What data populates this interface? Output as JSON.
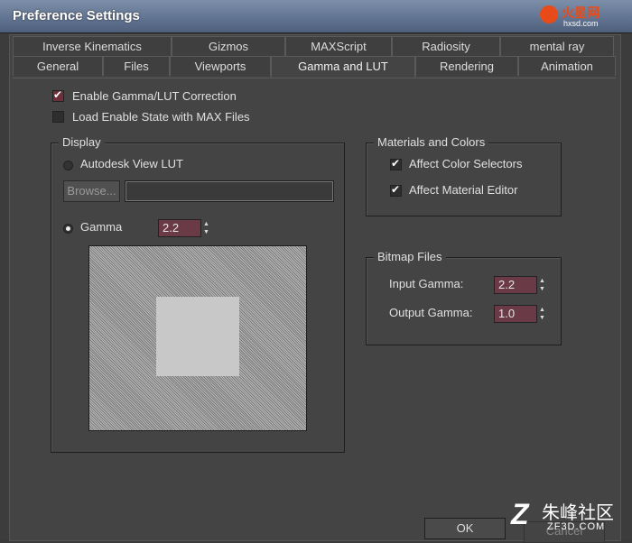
{
  "window": {
    "title": "Preference Settings"
  },
  "logo": {
    "name": "火星网",
    "url": "hxsd.com"
  },
  "tabs": {
    "row1": [
      "Inverse Kinematics",
      "Gizmos",
      "MAXScript",
      "Radiosity",
      "mental ray"
    ],
    "row2": [
      "General",
      "Files",
      "Viewports",
      "Gamma and LUT",
      "Rendering",
      "Animation"
    ],
    "active": "Gamma and LUT"
  },
  "options": {
    "enable_gamma": {
      "label": "Enable Gamma/LUT Correction",
      "checked": true
    },
    "load_enable_state": {
      "label": "Load Enable State with MAX Files",
      "checked": false
    }
  },
  "display": {
    "title": "Display",
    "lut_label": "Autodesk View LUT",
    "browse_label": "Browse...",
    "path_value": "",
    "gamma_label": "Gamma",
    "gamma_value": "2.2",
    "gamma_selected": true
  },
  "materials": {
    "title": "Materials and Colors",
    "affect_color_selectors": {
      "label": "Affect Color Selectors",
      "checked": true
    },
    "affect_material_editor": {
      "label": "Affect Material Editor",
      "checked": true
    }
  },
  "bitmap": {
    "title": "Bitmap Files",
    "input_gamma_label": "Input Gamma:",
    "input_gamma_value": "2.2",
    "output_gamma_label": "Output Gamma:",
    "output_gamma_value": "1.0"
  },
  "footer": {
    "ok_label": "OK",
    "cancel_label": "Cancel"
  },
  "watermark": {
    "glyph": "Z",
    "cn": "朱峰社区",
    "en": "ZF3D.COM"
  }
}
